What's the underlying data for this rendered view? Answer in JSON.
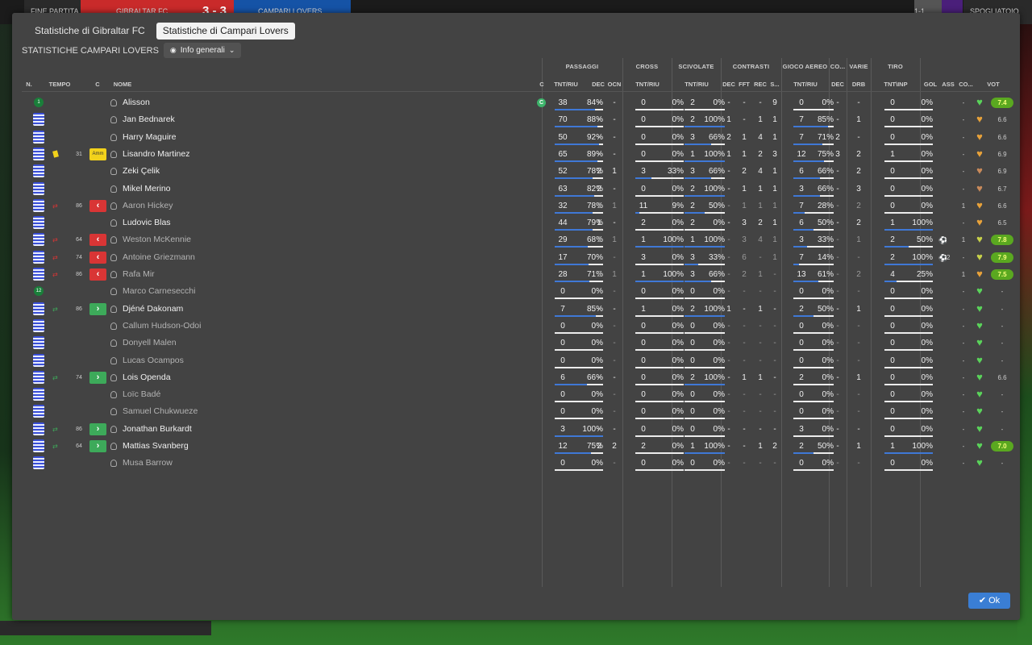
{
  "topbar": {
    "left_label": "FINE PARTITA",
    "home_team": "GIBRALTAR FC",
    "score": "3 - 3",
    "away_team": "CAMPARI LOVERS",
    "right_label": "SPOGLIATOIO",
    "right_mid": "1-1"
  },
  "tabs": [
    "Statistiche di Gibraltar FC",
    "Statistiche di Campari Lovers"
  ],
  "subheader": {
    "title": "STATISTICHE CAMPARI LOVERS",
    "view": "Info generali"
  },
  "groups": {
    "passaggi": "PASSAGGI",
    "cross": "CROSS",
    "scivolate": "SCIVOLATE",
    "contrasti": "CONTRASTI",
    "gioco_aereo": "GIOCO AEREO",
    "co": "CO...",
    "varie": "VARIE",
    "tiro": "TIRO"
  },
  "headers": {
    "n": "N.",
    "tempo": "TEMPO",
    "c": "C",
    "nome": "NOME",
    "c2": "C",
    "tnt_riu": "TNT/RIU",
    "dec": "DEC",
    "ocn": "OCN",
    "fft": "FFT",
    "rec": "REC",
    "s": "S...",
    "drb": "DRB",
    "tnt_inp": "TNT\\INP",
    "gol": "GOL",
    "ass": "ASS",
    "co2": "CO...",
    "vot": "VOT"
  },
  "players": [
    {
      "num": "1",
      "gk": true,
      "name": "Alisson",
      "captain": "C",
      "card": "",
      "min": "",
      "sub": "",
      "dim": false,
      "pass": [
        "38",
        "84%"
      ],
      "pdec": "-",
      "pocn": "-",
      "cross": [
        "0",
        "0%"
      ],
      "sciv": [
        "2",
        "0%"
      ],
      "cdec": "-",
      "fft": "-",
      "rec": "-",
      "s": "9",
      "aer": [
        "0",
        "0%"
      ],
      "co": "-",
      "drb": "-",
      "tiro": [
        "0",
        "0%"
      ],
      "gol": "",
      "ass": "-",
      "morale": "green",
      "vot": "7.4"
    },
    {
      "num": "2",
      "name": "Jan Bednarek",
      "pass": [
        "70",
        "88%"
      ],
      "pdec": "-",
      "pocn": "-",
      "cross": [
        "0",
        "0%"
      ],
      "sciv": [
        "2",
        "100%"
      ],
      "cdec": "1",
      "fft": "-",
      "rec": "1",
      "s": "1",
      "aer": [
        "7",
        "85%"
      ],
      "co": "-",
      "drb": "1",
      "tiro": [
        "0",
        "0%"
      ],
      "ass": "-",
      "morale": "orange",
      "vot": "6.6"
    },
    {
      "num": "5",
      "name": "Harry Maguire",
      "pass": [
        "50",
        "92%"
      ],
      "pdec": "-",
      "pocn": "-",
      "cross": [
        "0",
        "0%"
      ],
      "sciv": [
        "3",
        "66%"
      ],
      "cdec": "2",
      "fft": "1",
      "rec": "4",
      "s": "1",
      "aer": [
        "7",
        "71%"
      ],
      "co": "2",
      "drb": "-",
      "tiro": [
        "0",
        "0%"
      ],
      "ass": "-",
      "morale": "orange",
      "vot": "6.6"
    },
    {
      "num": "6",
      "name": "Lisandro Martinez",
      "card": "yellow",
      "min": "31",
      "sub": "amm",
      "amm": "Amm",
      "pass": [
        "65",
        "89%"
      ],
      "pdec": "-",
      "pocn": "-",
      "cross": [
        "0",
        "0%"
      ],
      "sciv": [
        "1",
        "100%"
      ],
      "cdec": "1",
      "fft": "1",
      "rec": "2",
      "s": "3",
      "aer": [
        "12",
        "75%"
      ],
      "co": "3",
      "drb": "2",
      "tiro": [
        "1",
        "0%"
      ],
      "ass": "-",
      "morale": "orange",
      "vot": "6.9"
    },
    {
      "num": "8",
      "name": "Zeki Çelik",
      "pass": [
        "52",
        "78%"
      ],
      "pdec": "2",
      "pocn": "1",
      "cross": [
        "3",
        "33%"
      ],
      "sciv": [
        "3",
        "66%"
      ],
      "cdec": "-",
      "fft": "2",
      "rec": "4",
      "s": "1",
      "aer": [
        "6",
        "66%"
      ],
      "co": "-",
      "drb": "2",
      "tiro": [
        "0",
        "0%"
      ],
      "ass": "-",
      "morale": "brown",
      "vot": "6.9"
    },
    {
      "num": "10",
      "name": "Mikel Merino",
      "pass": [
        "63",
        "82%"
      ],
      "pdec": "2",
      "pocn": "-",
      "cross": [
        "0",
        "0%"
      ],
      "sciv": [
        "2",
        "100%"
      ],
      "cdec": "-",
      "fft": "1",
      "rec": "1",
      "s": "1",
      "aer": [
        "3",
        "66%"
      ],
      "co": "-",
      "drb": "3",
      "tiro": [
        "0",
        "0%"
      ],
      "ass": "-",
      "morale": "brown",
      "vot": "6.7"
    },
    {
      "num": "11",
      "name": "Aaron Hickey",
      "dim": true,
      "card": "sub",
      "min": "86",
      "sub": "out",
      "pass": [
        "32",
        "78%"
      ],
      "pdec": "1",
      "pocn": "1",
      "cross": [
        "11",
        "9%"
      ],
      "sciv": [
        "2",
        "50%"
      ],
      "cdec": "-",
      "fft": "1",
      "rec": "1",
      "s": "1",
      "aer": [
        "7",
        "28%"
      ],
      "co": "-",
      "drb": "2",
      "tiro": [
        "0",
        "0%"
      ],
      "ass": "1",
      "morale": "orange",
      "vot": "6.6"
    },
    {
      "num": "14",
      "name": "Ludovic Blas",
      "pass": [
        "44",
        "79%"
      ],
      "pdec": "1",
      "pocn": "-",
      "cross": [
        "2",
        "0%"
      ],
      "sciv": [
        "2",
        "0%"
      ],
      "cdec": "-",
      "fft": "3",
      "rec": "2",
      "s": "1",
      "aer": [
        "6",
        "50%"
      ],
      "co": "-",
      "drb": "2",
      "tiro": [
        "1",
        "100%"
      ],
      "ass": "-",
      "morale": "orange",
      "vot": "6.5"
    },
    {
      "num": "15",
      "name": "Weston McKennie",
      "dim": true,
      "card": "sub",
      "min": "64",
      "sub": "out",
      "pass": [
        "29",
        "68%"
      ],
      "pdec": "1",
      "pocn": "1",
      "cross": [
        "1",
        "100%"
      ],
      "sciv": [
        "1",
        "100%"
      ],
      "cdec": "-",
      "fft": "3",
      "rec": "4",
      "s": "1",
      "aer": [
        "3",
        "33%"
      ],
      "co": "-",
      "drb": "1",
      "tiro": [
        "2",
        "50%"
      ],
      "gol": "ball",
      "goln": "",
      "ass": "1",
      "morale": "yellow",
      "vot": "7.8"
    },
    {
      "num": "17",
      "name": "Antoine Griezmann",
      "dim": true,
      "card": "sub",
      "min": "74",
      "sub": "out",
      "pass": [
        "17",
        "70%"
      ],
      "pdec": "-",
      "pocn": "-",
      "cross": [
        "3",
        "0%"
      ],
      "sciv": [
        "3",
        "33%"
      ],
      "cdec": "-",
      "fft": "6",
      "rec": "-",
      "s": "1",
      "aer": [
        "7",
        "14%"
      ],
      "co": "-",
      "drb": "-",
      "tiro": [
        "2",
        "100%"
      ],
      "gol": "ball",
      "goln": "2",
      "ass": "-",
      "morale": "yellow",
      "vot": "7.9"
    },
    {
      "num": "19",
      "name": "Rafa Mir",
      "dim": true,
      "card": "sub",
      "min": "86",
      "sub": "out",
      "pass": [
        "28",
        "71%"
      ],
      "pdec": "2",
      "pocn": "1",
      "cross": [
        "1",
        "100%"
      ],
      "sciv": [
        "3",
        "66%"
      ],
      "cdec": "-",
      "fft": "2",
      "rec": "1",
      "s": "-",
      "aer": [
        "13",
        "61%"
      ],
      "co": "-",
      "drb": "2",
      "tiro": [
        "4",
        "25%"
      ],
      "ass": "1",
      "morale": "orange",
      "vot": "7.5"
    },
    {
      "num": "12",
      "gk": true,
      "name": "Marco Carnesecchi",
      "dim": true,
      "pass": [
        "0",
        "0%"
      ],
      "pdec": "-",
      "pocn": "-",
      "cross": [
        "0",
        "0%"
      ],
      "sciv": [
        "0",
        "0%"
      ],
      "cdec": "-",
      "fft": "-",
      "rec": "-",
      "s": "-",
      "aer": [
        "0",
        "0%"
      ],
      "co": "-",
      "drb": "-",
      "tiro": [
        "0",
        "0%"
      ],
      "ass": "-",
      "morale": "green",
      "vot": "-"
    },
    {
      "num": "18",
      "name": "Djéné Dakonam",
      "card": "sub",
      "min": "86",
      "sub": "in",
      "pass": [
        "7",
        "85%"
      ],
      "pdec": "-",
      "pocn": "-",
      "cross": [
        "1",
        "0%"
      ],
      "sciv": [
        "2",
        "100%"
      ],
      "cdec": "1",
      "fft": "-",
      "rec": "1",
      "s": "-",
      "aer": [
        "2",
        "50%"
      ],
      "co": "-",
      "drb": "1",
      "tiro": [
        "0",
        "0%"
      ],
      "ass": "-",
      "morale": "green",
      "vot": "-"
    },
    {
      "num": "20",
      "name": "Callum Hudson-Odoi",
      "dim": true,
      "pass": [
        "0",
        "0%"
      ],
      "pdec": "-",
      "pocn": "-",
      "cross": [
        "0",
        "0%"
      ],
      "sciv": [
        "0",
        "0%"
      ],
      "cdec": "-",
      "fft": "-",
      "rec": "-",
      "s": "-",
      "aer": [
        "0",
        "0%"
      ],
      "co": "-",
      "drb": "-",
      "tiro": [
        "0",
        "0%"
      ],
      "ass": "-",
      "morale": "green",
      "vot": "-"
    },
    {
      "num": "21",
      "name": "Donyell Malen",
      "dim": true,
      "pass": [
        "0",
        "0%"
      ],
      "pdec": "-",
      "pocn": "-",
      "cross": [
        "0",
        "0%"
      ],
      "sciv": [
        "0",
        "0%"
      ],
      "cdec": "-",
      "fft": "-",
      "rec": "-",
      "s": "-",
      "aer": [
        "0",
        "0%"
      ],
      "co": "-",
      "drb": "-",
      "tiro": [
        "0",
        "0%"
      ],
      "ass": "-",
      "morale": "green",
      "vot": "-"
    },
    {
      "num": "22",
      "name": "Lucas Ocampos",
      "dim": true,
      "pass": [
        "0",
        "0%"
      ],
      "pdec": "-",
      "pocn": "-",
      "cross": [
        "0",
        "0%"
      ],
      "sciv": [
        "0",
        "0%"
      ],
      "cdec": "-",
      "fft": "-",
      "rec": "-",
      "s": "-",
      "aer": [
        "0",
        "0%"
      ],
      "co": "-",
      "drb": "-",
      "tiro": [
        "0",
        "0%"
      ],
      "ass": "-",
      "morale": "green",
      "vot": "-"
    },
    {
      "num": "23",
      "name": "Lois Openda",
      "card": "sub",
      "min": "74",
      "sub": "in",
      "pass": [
        "6",
        "66%"
      ],
      "pdec": "-",
      "pocn": "-",
      "cross": [
        "0",
        "0%"
      ],
      "sciv": [
        "2",
        "100%"
      ],
      "cdec": "-",
      "fft": "1",
      "rec": "1",
      "s": "-",
      "aer": [
        "2",
        "0%"
      ],
      "co": "-",
      "drb": "1",
      "tiro": [
        "0",
        "0%"
      ],
      "ass": "-",
      "morale": "green",
      "vot": "6.6"
    },
    {
      "num": "24",
      "name": "Loïc Badé",
      "dim": true,
      "pass": [
        "0",
        "0%"
      ],
      "pdec": "-",
      "pocn": "-",
      "cross": [
        "0",
        "0%"
      ],
      "sciv": [
        "0",
        "0%"
      ],
      "cdec": "-",
      "fft": "-",
      "rec": "-",
      "s": "-",
      "aer": [
        "0",
        "0%"
      ],
      "co": "-",
      "drb": "-",
      "tiro": [
        "0",
        "0%"
      ],
      "ass": "-",
      "morale": "green",
      "vot": "-"
    },
    {
      "num": "25",
      "name": "Samuel Chukwueze",
      "dim": true,
      "pass": [
        "0",
        "0%"
      ],
      "pdec": "-",
      "pocn": "-",
      "cross": [
        "0",
        "0%"
      ],
      "sciv": [
        "0",
        "0%"
      ],
      "cdec": "-",
      "fft": "-",
      "rec": "-",
      "s": "-",
      "aer": [
        "0",
        "0%"
      ],
      "co": "-",
      "drb": "-",
      "tiro": [
        "0",
        "0%"
      ],
      "ass": "-",
      "morale": "green",
      "vot": "-"
    },
    {
      "num": "26",
      "name": "Jonathan Burkardt",
      "card": "sub",
      "min": "86",
      "sub": "in",
      "pass": [
        "3",
        "100%"
      ],
      "pdec": "-",
      "pocn": "-",
      "cross": [
        "0",
        "0%"
      ],
      "sciv": [
        "0",
        "0%"
      ],
      "cdec": "-",
      "fft": "-",
      "rec": "-",
      "s": "-",
      "aer": [
        "3",
        "0%"
      ],
      "co": "-",
      "drb": "-",
      "tiro": [
        "0",
        "0%"
      ],
      "ass": "-",
      "morale": "green",
      "vot": "-"
    },
    {
      "num": "27",
      "name": "Mattias Svanberg",
      "card": "sub",
      "min": "64",
      "sub": "in",
      "pass": [
        "12",
        "75%"
      ],
      "pdec": "2",
      "pocn": "2",
      "cross": [
        "2",
        "0%"
      ],
      "sciv": [
        "1",
        "100%"
      ],
      "cdec": "-",
      "fft": "-",
      "rec": "1",
      "s": "2",
      "aer": [
        "2",
        "50%"
      ],
      "co": "-",
      "drb": "1",
      "tiro": [
        "1",
        "100%"
      ],
      "ass": "-",
      "morale": "green",
      "vot": "7.0"
    },
    {
      "num": "28",
      "name": "Musa Barrow",
      "dim": true,
      "pass": [
        "0",
        "0%"
      ],
      "pdec": "-",
      "pocn": "-",
      "cross": [
        "0",
        "0%"
      ],
      "sciv": [
        "0",
        "0%"
      ],
      "cdec": "-",
      "fft": "-",
      "rec": "-",
      "s": "-",
      "aer": [
        "0",
        "0%"
      ],
      "co": "-",
      "drb": "-",
      "tiro": [
        "0",
        "0%"
      ],
      "ass": "-",
      "morale": "green",
      "vot": "-"
    }
  ],
  "colors": {
    "accent": "#3a7ed4",
    "bar": "#3f78d6",
    "sub_out": "#d93535",
    "sub_in": "#3daa5a",
    "yellow_card": "#f2d21b"
  },
  "footer": {
    "ok_label": "Ok"
  }
}
